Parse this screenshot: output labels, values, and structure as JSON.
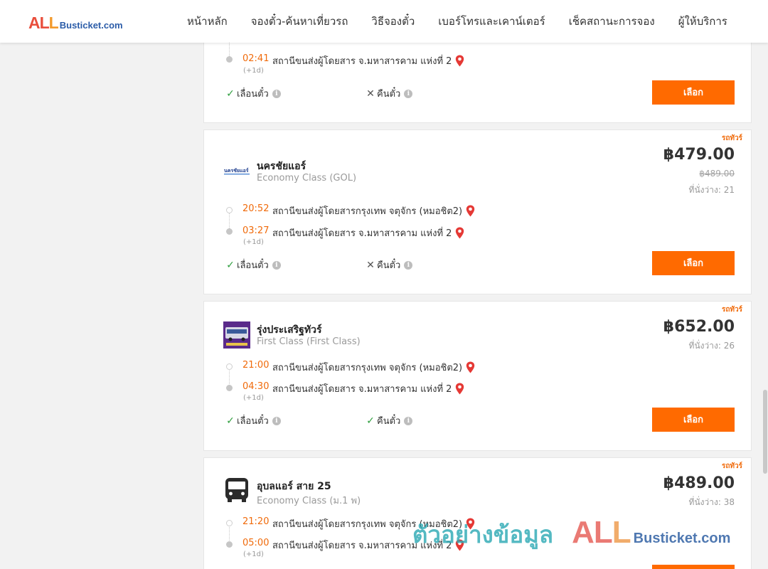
{
  "header": {
    "logo_all": "ALL",
    "logo_busticket": "Busticket.com",
    "nav": [
      "หน้าหลัก",
      "จองตั๋ว-ค้นหาเที่ยวรถ",
      "วิธีจองตั๋ว",
      "เบอร์โทรและเคาน์เตอร์",
      "เช็คสถานะการจอง",
      "ผู้ให้บริการ"
    ]
  },
  "labels": {
    "change_ticket": "เลื่อนตั๋ว",
    "refund_ticket": "คืนตั๋ว",
    "select": "เลือก",
    "badge": "รถทัวร์",
    "seats_prefix": "ที่นั่งว่าง:",
    "plus_day": "(+1d)"
  },
  "cards": [
    {
      "arrive_time": "02:41",
      "arrive_station": "สถานีขนส่งผู้โดยสาร จ.มหาสารคาม แห่งที่ 2",
      "change_ok": true,
      "refund_ok": false
    },
    {
      "operator": "นครชัยแอร์",
      "class": "Economy Class (GOL)",
      "price": "฿479.00",
      "old_price": "฿489.00",
      "seats": "21",
      "depart_time": "20:52",
      "depart_station": "สถานีขนส่งผู้โดยสารกรุงเทพ จตุจักร (หมอชิต2)",
      "arrive_time": "03:27",
      "arrive_station": "สถานีขนส่งผู้โดยสาร จ.มหาสารคาม แห่งที่ 2",
      "change_ok": true,
      "refund_ok": false
    },
    {
      "operator": "รุ่งประเสริฐทัวร์",
      "class": "First Class (First Class)",
      "price": "฿652.00",
      "seats": "26",
      "depart_time": "21:00",
      "depart_station": "สถานีขนส่งผู้โดยสารกรุงเทพ จตุจักร (หมอชิต2)",
      "arrive_time": "04:30",
      "arrive_station": "สถานีขนส่งผู้โดยสาร จ.มหาสารคาม แห่งที่ 2",
      "change_ok": true,
      "refund_ok": true
    },
    {
      "operator": "อุบลแอร์ สาย 25",
      "class": "Economy Class (ม.1 พ)",
      "price": "฿489.00",
      "seats": "38",
      "depart_time": "21:20",
      "depart_station": "สถานีขนส่งผู้โดยสารกรุงเทพ จตุจักร (หมอชิต2)",
      "arrive_time": "05:00",
      "arrive_station": "สถานีขนส่งผู้โดยสาร จ.มหาสารคาม แห่งที่ 2"
    }
  ],
  "watermark": {
    "thai": "ตัวอย่างข้อมูล",
    "all": "ALL",
    "busticket": "Busticket.com"
  },
  "colors": {
    "accent_orange": "#ff6a00",
    "time_orange": "#f06a0a",
    "check_green": "#2e9e3e",
    "pin_red": "#e53935"
  }
}
